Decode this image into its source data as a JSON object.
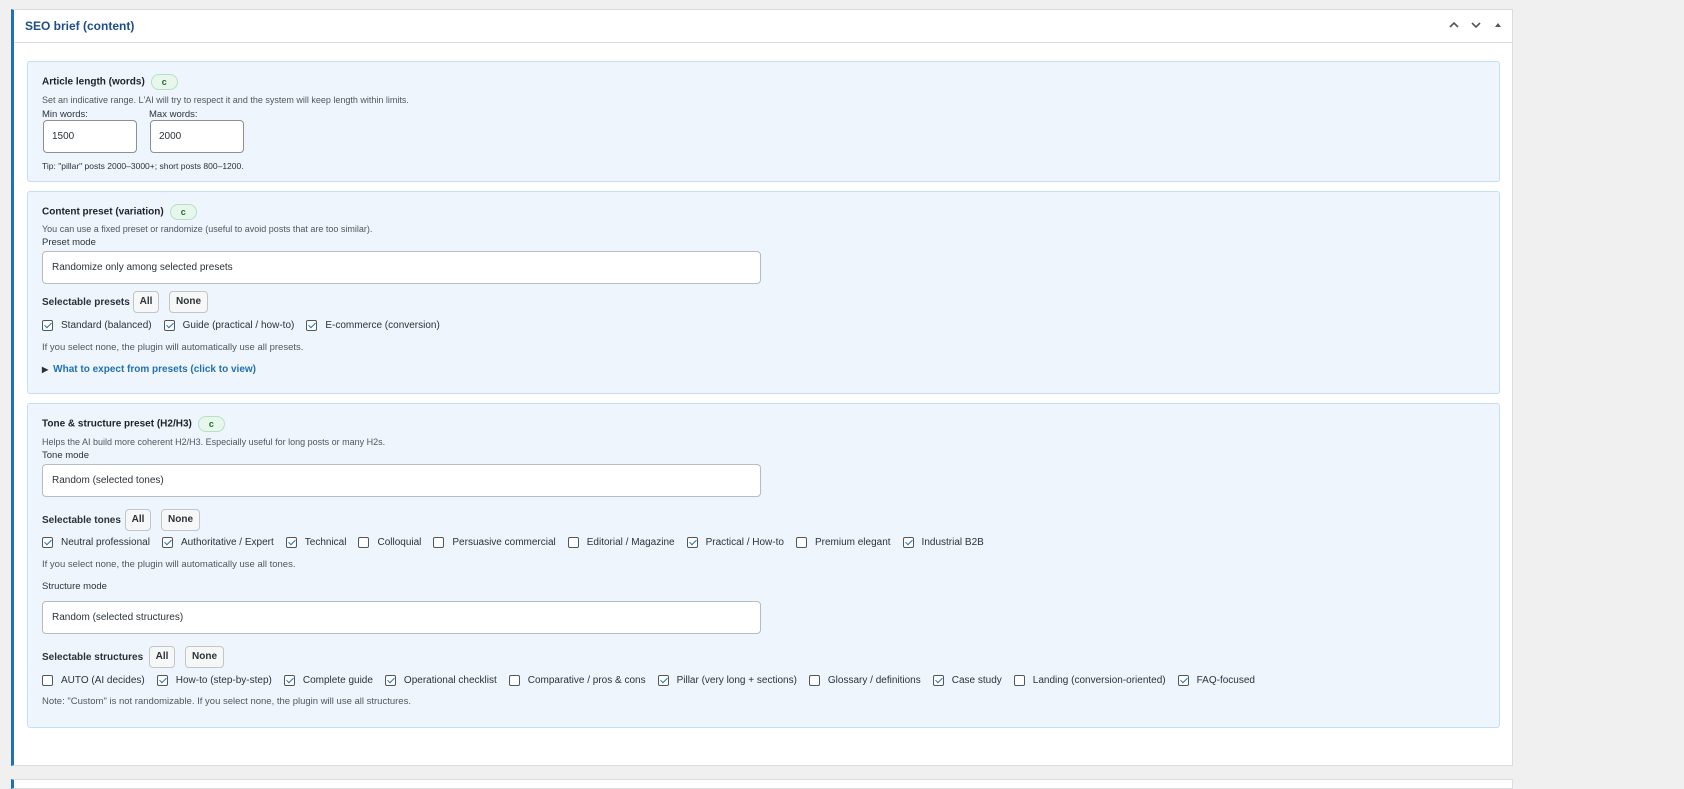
{
  "metabox": {
    "title": "SEO brief (content)",
    "controls": [
      "chevron-up-icon",
      "chevron-down-icon",
      "triangle-up-icon"
    ]
  },
  "article_length": {
    "title": "Article length (words)",
    "badge": "c",
    "description": "Set an indicative range. L'AI will try to respect it and the system will keep length within limits.",
    "min_label": "Min words:",
    "min_value": "1500",
    "max_label": "Max words:",
    "max_value": "2000",
    "tip": "Tip: \"pillar\" posts 2000–3000+; short posts 800–1200."
  },
  "content_preset": {
    "title": "Content preset (variation)",
    "badge": "c",
    "description": "You can use a fixed preset or randomize (useful to avoid posts that are too similar).",
    "mode_label": "Preset mode",
    "mode_value": "Randomize only among selected presets",
    "selectable_label": "Selectable presets",
    "all_label": "All",
    "none_label": "None",
    "options": [
      {
        "label": "Standard (balanced)",
        "checked": true
      },
      {
        "label": "Guide (practical / how-to)",
        "checked": true
      },
      {
        "label": "E-commerce (conversion)",
        "checked": true
      }
    ],
    "note": "If you select none, the plugin will automatically use all presets.",
    "details_label": "What to expect from presets (click to view)"
  },
  "tone_structure": {
    "title": "Tone & structure preset (H2/H3)",
    "badge": "c",
    "description": "Helps the AI build more coherent H2/H3. Especially useful for long posts or many H2s.",
    "tone_mode_label": "Tone mode",
    "tone_mode_value": "Random (selected tones)",
    "tones_label": "Selectable tones",
    "all_label": "All",
    "none_label": "None",
    "tones": [
      {
        "label": "Neutral professional",
        "checked": true
      },
      {
        "label": "Authoritative / Expert",
        "checked": true
      },
      {
        "label": "Technical",
        "checked": true
      },
      {
        "label": "Colloquial",
        "checked": false
      },
      {
        "label": "Persuasive commercial",
        "checked": false
      },
      {
        "label": "Editorial / Magazine",
        "checked": false
      },
      {
        "label": "Practical / How-to",
        "checked": true
      },
      {
        "label": "Premium elegant",
        "checked": false
      },
      {
        "label": "Industrial B2B",
        "checked": true
      }
    ],
    "tones_note": "If you select none, the plugin will automatically use all tones.",
    "structure_mode_label": "Structure mode",
    "structure_mode_value": "Random (selected structures)",
    "structures_label": "Selectable structures",
    "structures": [
      {
        "label": "AUTO (AI decides)",
        "checked": false
      },
      {
        "label": "How-to (step-by-step)",
        "checked": true
      },
      {
        "label": "Complete guide",
        "checked": true
      },
      {
        "label": "Operational checklist",
        "checked": true
      },
      {
        "label": "Comparative / pros & cons",
        "checked": false
      },
      {
        "label": "Pillar (very long + sections)",
        "checked": true
      },
      {
        "label": "Glossary / definitions",
        "checked": false
      },
      {
        "label": "Case study",
        "checked": true
      },
      {
        "label": "Landing (conversion-oriented)",
        "checked": false
      },
      {
        "label": "FAQ-focused",
        "checked": true
      }
    ],
    "structures_note": "Note: \"Custom\" is not randomizable. If you select none, the plugin will use all structures."
  }
}
